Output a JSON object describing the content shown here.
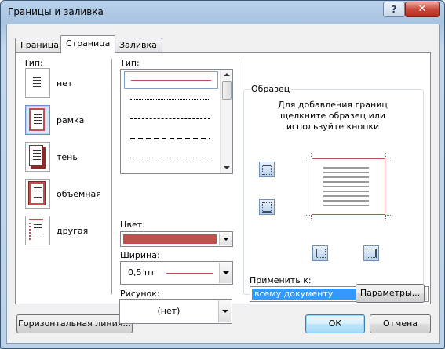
{
  "window": {
    "title": "Границы и заливка",
    "help": "?",
    "close": "✕"
  },
  "tabs": [
    {
      "label": "Граница",
      "active": false
    },
    {
      "label": "Страница",
      "active": true
    },
    {
      "label": "Заливка",
      "active": false
    }
  ],
  "settings": {
    "label": "Тип:",
    "items": [
      {
        "label": "нет",
        "icon": "none-border-icon"
      },
      {
        "label": "рамка",
        "icon": "box-border-icon",
        "selected": true
      },
      {
        "label": "тень",
        "icon": "shadow-border-icon"
      },
      {
        "label": "объемная",
        "icon": "3d-border-icon"
      },
      {
        "label": "другая",
        "icon": "custom-border-icon"
      }
    ]
  },
  "style": {
    "label": "Тип:",
    "items": [
      "solid",
      "dotted",
      "dashed-small",
      "dashed",
      "dash-dot"
    ]
  },
  "color": {
    "label": "Цвет:",
    "value_color": "#c0504d"
  },
  "width": {
    "label": "Ширина:",
    "value": "0,5 пт"
  },
  "art": {
    "label": "Рисунок:",
    "value": "(нет)"
  },
  "preview": {
    "label": "Образец",
    "hint_line1": "Для добавления границ",
    "hint_line2": "щелкните образец или",
    "hint_line3": "используйте кнопки",
    "border_color": "#c0504d"
  },
  "apply_to": {
    "label": "Применить к:",
    "value": "всему документу"
  },
  "buttons": {
    "options": "Параметры...",
    "horizontal_line": "Горизонтальная линия...",
    "ok": "ОК",
    "cancel": "Отмена"
  }
}
